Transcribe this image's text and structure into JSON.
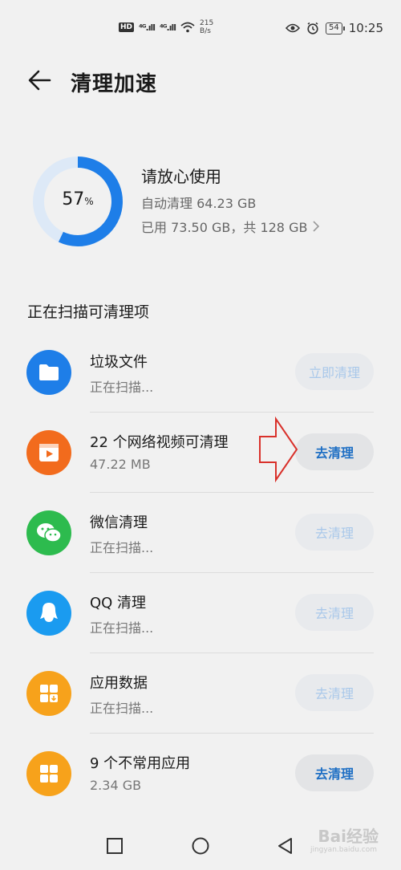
{
  "status_bar": {
    "hd_label": "HD",
    "signal_1": "⁴ᴳ.ıll",
    "signal_2": "⁴ᴳ.ıll",
    "speed_value": "215",
    "speed_unit": "B/s",
    "battery": "54",
    "time": "10:25"
  },
  "header": {
    "title": "清理加速"
  },
  "summary": {
    "percent": "57",
    "percent_unit": "%",
    "percent_fraction": 0.57,
    "title": "请放心使用",
    "auto_clean": "自动清理 64.23 GB",
    "used": "已用 73.50 GB，共 128 GB"
  },
  "section_title": "正在扫描可清理项",
  "items": [
    {
      "title": "垃圾文件",
      "subtitle": "正在扫描...",
      "button": "立即清理",
      "icon": "folder-icon",
      "color": "#1e7ee8"
    },
    {
      "title": "22 个网络视频可清理",
      "subtitle": "47.22 MB",
      "button": "去清理",
      "icon": "video-icon",
      "color": "#f26b1d"
    },
    {
      "title": "微信清理",
      "subtitle": "正在扫描...",
      "button": "去清理",
      "icon": "wechat-icon",
      "color": "#2dbb4e"
    },
    {
      "title": "QQ 清理",
      "subtitle": "正在扫描...",
      "button": "去清理",
      "icon": "qq-icon",
      "color": "#1a9bf0"
    },
    {
      "title": "应用数据",
      "subtitle": "正在扫描...",
      "button": "去清理",
      "icon": "app-data-icon",
      "color": "#f7a21b"
    },
    {
      "title": "9 个不常用应用",
      "subtitle": "2.34 GB",
      "button": "去清理",
      "icon": "apps-grid-icon",
      "color": "#f7a21b"
    }
  ],
  "watermark": {
    "brand": "Bai经验",
    "site": "jingyan.baidu.com"
  },
  "colors": {
    "accent": "#1e7ee8",
    "ring_track": "#dde9f7",
    "annotation_arrow": "#d9312b"
  }
}
